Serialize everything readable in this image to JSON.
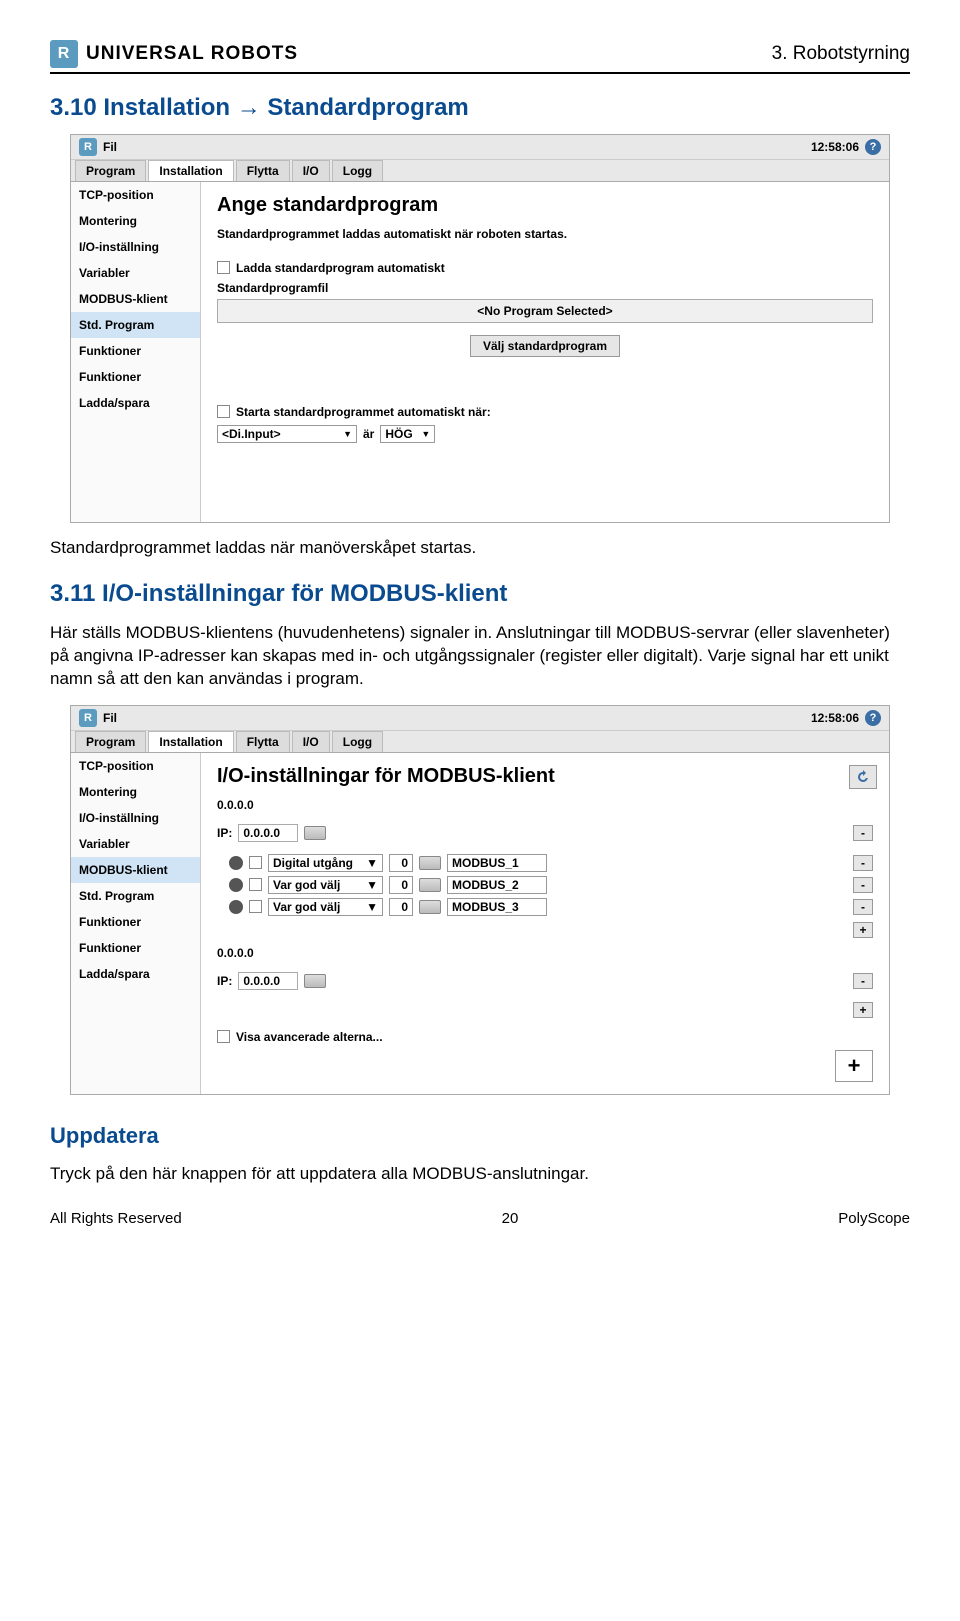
{
  "header": {
    "brand": "UNIVERSAL ROBOTS",
    "chapter": "3. Robotstyrning"
  },
  "section1": {
    "title": "3.10   Installation → Standardprogram",
    "body": "Standardprogrammet laddas när manöverskåpet startas."
  },
  "section2": {
    "title": "3.11   I/O-inställningar för MODBUS-klient",
    "body": "Här ställs MODBUS-klientens (huvudenhetens) signaler in. Anslutningar till MODBUS-servrar (eller slavenheter) på angivna IP-adresser kan skapas med in- och utgångssignaler (register eller digitalt). Varje signal har ett unikt namn så att den kan användas i program."
  },
  "app": {
    "fil": "Fil",
    "time": "12:58:06",
    "tabs": [
      "Program",
      "Installation",
      "Flytta",
      "I/O",
      "Logg"
    ],
    "sidebar": [
      "TCP-position",
      "Montering",
      "I/O-inställning",
      "Variabler",
      "MODBUS-klient",
      "Std. Program",
      "Funktioner",
      "Funktioner",
      "Ladda/spara"
    ]
  },
  "screen1": {
    "heading": "Ange standardprogram",
    "desc": "Standardprogrammet laddas automatiskt när roboten startas.",
    "chk_auto": "Ladda standardprogram automatiskt",
    "file_label": "Standardprogramfil",
    "no_program": "<No Program Selected>",
    "choose_btn": "Välj standardprogram",
    "chk_auto2": "Starta standardprogrammet automatiskt när:",
    "input_sel": "<Di.Input>",
    "ar": "är",
    "hog": "HÖG"
  },
  "screen2": {
    "heading": "I/O-inställningar för MODBUS-klient",
    "ip_group": "0.0.0.0",
    "ip_label": "IP:",
    "ip_value": "0.0.0.0",
    "signals": [
      {
        "type": "Digital utgång",
        "addr": "0",
        "name": "MODBUS_1"
      },
      {
        "type": "Var god välj",
        "addr": "0",
        "name": "MODBUS_2"
      },
      {
        "type": "Var god välj",
        "addr": "0",
        "name": "MODBUS_3"
      }
    ],
    "show_advanced": "Visa avancerade alterna...",
    "plus": "+",
    "minus": "-"
  },
  "sub": {
    "heading": "Uppdatera",
    "body": "Tryck på den här knappen för att uppdatera alla MODBUS-anslutningar."
  },
  "footer": {
    "left": "All Rights Reserved",
    "center": "20",
    "right": "PolyScope"
  }
}
